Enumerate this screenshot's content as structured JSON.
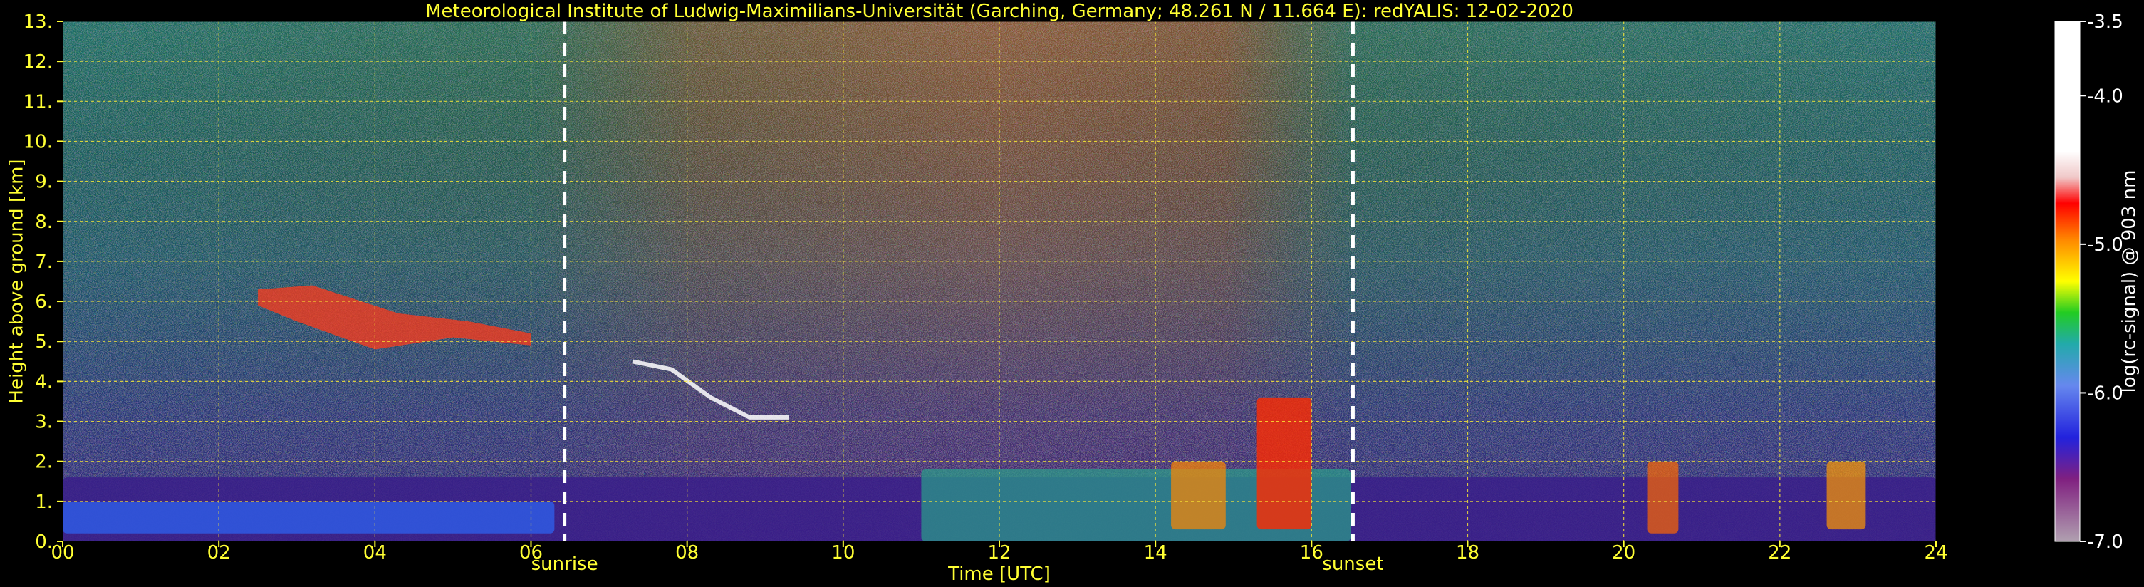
{
  "chart_data": {
    "type": "heatmap",
    "title": "Meteorological Institute of Ludwig-Maximilians-Universität (Garching, Germany; 48.261 N / 11.664 E):    redYALIS: 12-02-2020",
    "xlabel": "Time [UTC]",
    "ylabel": "Height above ground [km]",
    "xlim": [
      0,
      24
    ],
    "ylim": [
      0,
      13
    ],
    "x_tick_labels": [
      "00",
      "02",
      "04",
      "06",
      "08",
      "10",
      "12",
      "14",
      "16",
      "18",
      "20",
      "22",
      "24"
    ],
    "y_tick_labels": [
      "0.",
      "1.",
      "2.",
      "3.",
      "4.",
      "5.",
      "6.",
      "7.",
      "8.",
      "9.",
      "10.",
      "11.",
      "12.",
      "13."
    ],
    "grid": true,
    "colorbar": {
      "label": "log(rc-signal) @ 903 nm",
      "range": [
        -7.0,
        -3.5
      ],
      "tick_labels": [
        "-3.5",
        "-4.0",
        "-5.0",
        "-6.0",
        "-7.0"
      ],
      "tick_values": [
        -3.5,
        -4.0,
        -5.0,
        -6.0,
        -7.0
      ]
    },
    "annotations": [
      {
        "text": "sunrise",
        "x": 6.43
      },
      {
        "text": "sunset",
        "x": 16.53
      }
    ]
  }
}
